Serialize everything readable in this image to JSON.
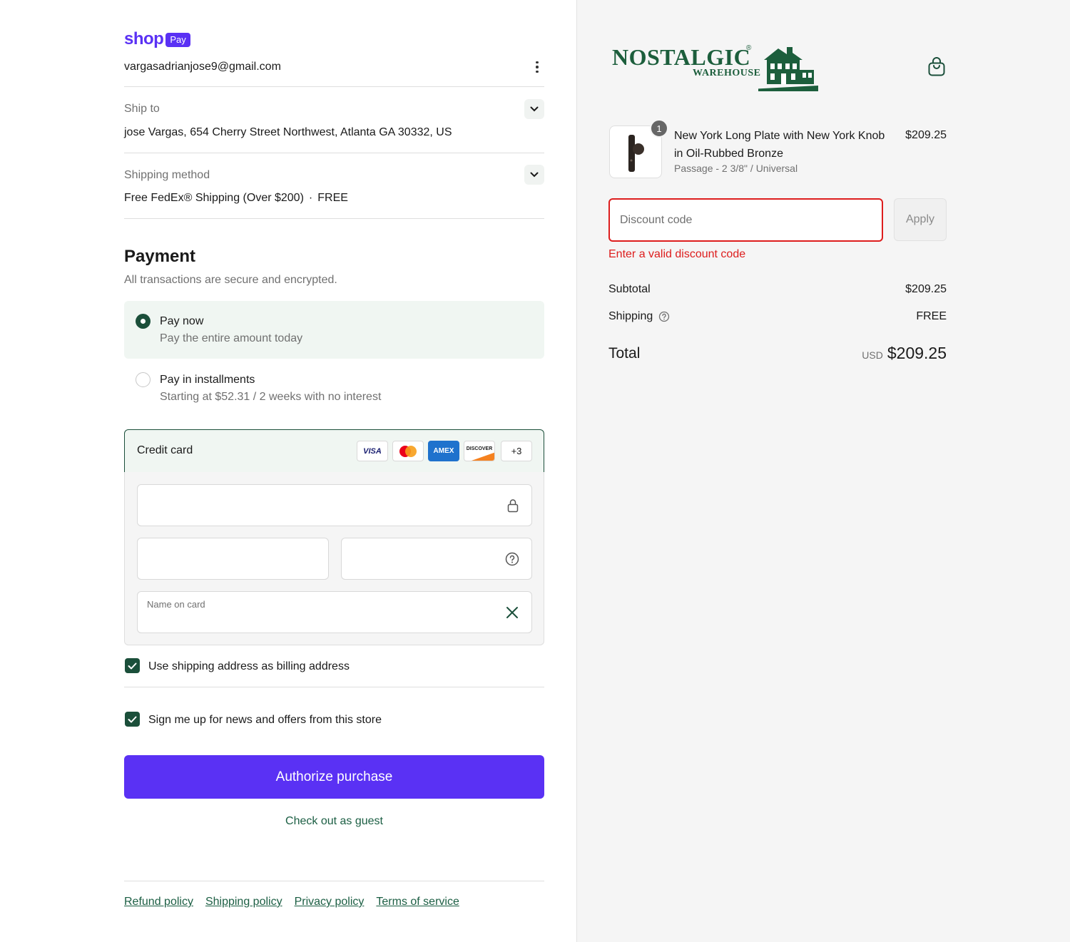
{
  "brand": {
    "shop_word": "shop",
    "pay_word": "Pay",
    "accent": "#5a31f4",
    "green": "#1b4f3a"
  },
  "account": {
    "email": "vargasadrianjose9@gmail.com"
  },
  "ship_to": {
    "label": "Ship to",
    "value": "jose Vargas, 654 Cherry Street Northwest, Atlanta GA 30332, US"
  },
  "shipping_method": {
    "label": "Shipping method",
    "value": "Free FedEx® Shipping (Over $200)",
    "separator": "·",
    "price": "FREE"
  },
  "payment": {
    "title": "Payment",
    "subtitle": "All transactions are secure and encrypted.",
    "options": [
      {
        "title": "Pay now",
        "subtitle": "Pay the entire amount today",
        "selected": true
      },
      {
        "title": "Pay in installments",
        "subtitle": "Starting at $52.31 / 2 weeks with no interest",
        "selected": false
      }
    ],
    "credit_card": {
      "label": "Credit card",
      "brands": [
        "VISA",
        "mastercard",
        "AMEX",
        "DISCOVER"
      ],
      "more": "+3",
      "name_placeholder": "Name on card"
    },
    "billing_checkbox": {
      "label": "Use shipping address as billing address",
      "checked": true
    },
    "news_checkbox": {
      "label": "Sign me up for news and offers from this store",
      "checked": true
    },
    "authorize_label": "Authorize purchase",
    "guest_label": "Check out as guest"
  },
  "footer": {
    "links": [
      "Refund policy",
      "Shipping policy",
      "Privacy policy",
      "Terms of service"
    ]
  },
  "store": {
    "logo_main": "NOSTALGIC",
    "logo_reg": "®",
    "logo_sub": "WAREHOUSE"
  },
  "cart": {
    "item": {
      "quantity": "1",
      "name": "New York Long Plate with New York Knob in Oil-Rubbed Bronze",
      "variant": "Passage - 2 3/8\" / Universal",
      "price": "$209.25"
    },
    "discount": {
      "placeholder": "Discount code",
      "apply_label": "Apply",
      "error": "Enter a valid discount code"
    },
    "summary": {
      "subtotal_label": "Subtotal",
      "subtotal_value": "$209.25",
      "shipping_label": "Shipping",
      "shipping_value": "FREE",
      "total_label": "Total",
      "currency": "USD",
      "total_value": "$209.25"
    }
  }
}
